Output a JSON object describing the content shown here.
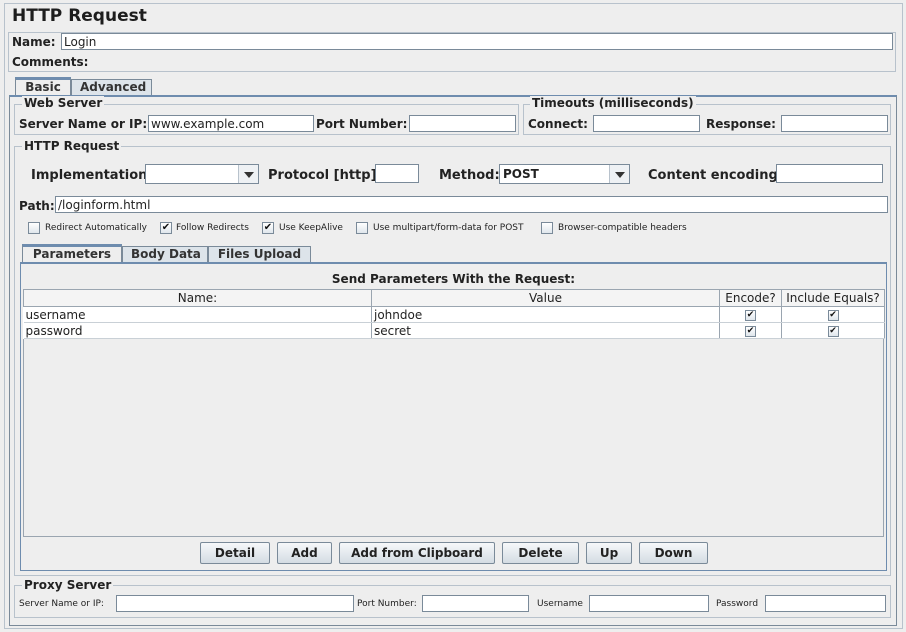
{
  "title": "HTTP Request",
  "name": {
    "label": "Name:",
    "value": "Login"
  },
  "comments": {
    "label": "Comments:",
    "value": ""
  },
  "main_tabs": [
    {
      "label": "Basic",
      "selected": true
    },
    {
      "label": "Advanced",
      "selected": false
    }
  ],
  "web_server": {
    "legend": "Web Server",
    "server_label": "Server Name or IP:",
    "server_value": "www.example.com",
    "port_label": "Port Number:",
    "port_value": ""
  },
  "timeouts": {
    "legend": "Timeouts (milliseconds)",
    "connect_label": "Connect:",
    "connect_value": "",
    "response_label": "Response:",
    "response_value": ""
  },
  "http_request": {
    "legend": "HTTP Request",
    "implementation_label": "Implementation:",
    "implementation_value": "",
    "protocol_label": "Protocol [http]:",
    "protocol_value": "",
    "method_label": "Method:",
    "method_value": "POST",
    "encoding_label": "Content encoding:",
    "encoding_value": "",
    "path_label": "Path:",
    "path_value": "/loginform.html"
  },
  "options": [
    {
      "label": "Redirect Automatically",
      "checked": false
    },
    {
      "label": "Follow Redirects",
      "checked": true
    },
    {
      "label": "Use KeepAlive",
      "checked": true
    },
    {
      "label": "Use multipart/form-data for POST",
      "checked": false
    },
    {
      "label": "Browser-compatible headers",
      "checked": false
    }
  ],
  "param_tabs": [
    {
      "label": "Parameters",
      "selected": true
    },
    {
      "label": "Body Data",
      "selected": false
    },
    {
      "label": "Files Upload",
      "selected": false
    }
  ],
  "params_table": {
    "caption": "Send Parameters With the Request:",
    "columns": [
      "Name:",
      "Value",
      "Encode?",
      "Include Equals?"
    ],
    "rows": [
      {
        "name": "username",
        "value": "johndoe",
        "encode": true,
        "include_equals": true
      },
      {
        "name": "password",
        "value": "secret",
        "encode": true,
        "include_equals": true
      }
    ]
  },
  "buttons": [
    "Detail",
    "Add",
    "Add from Clipboard",
    "Delete",
    "Up",
    "Down"
  ],
  "proxy": {
    "legend": "Proxy Server",
    "server_label": "Server Name or IP:",
    "server_value": "",
    "port_label": "Port Number:",
    "port_value": "",
    "username_label": "Username",
    "username_value": "",
    "password_label": "Password",
    "password_value": ""
  },
  "colors": {
    "background": "#eeeeee",
    "tab_accent": "#6e8cae",
    "border": "#7a8a99"
  },
  "checkmark": "✔"
}
